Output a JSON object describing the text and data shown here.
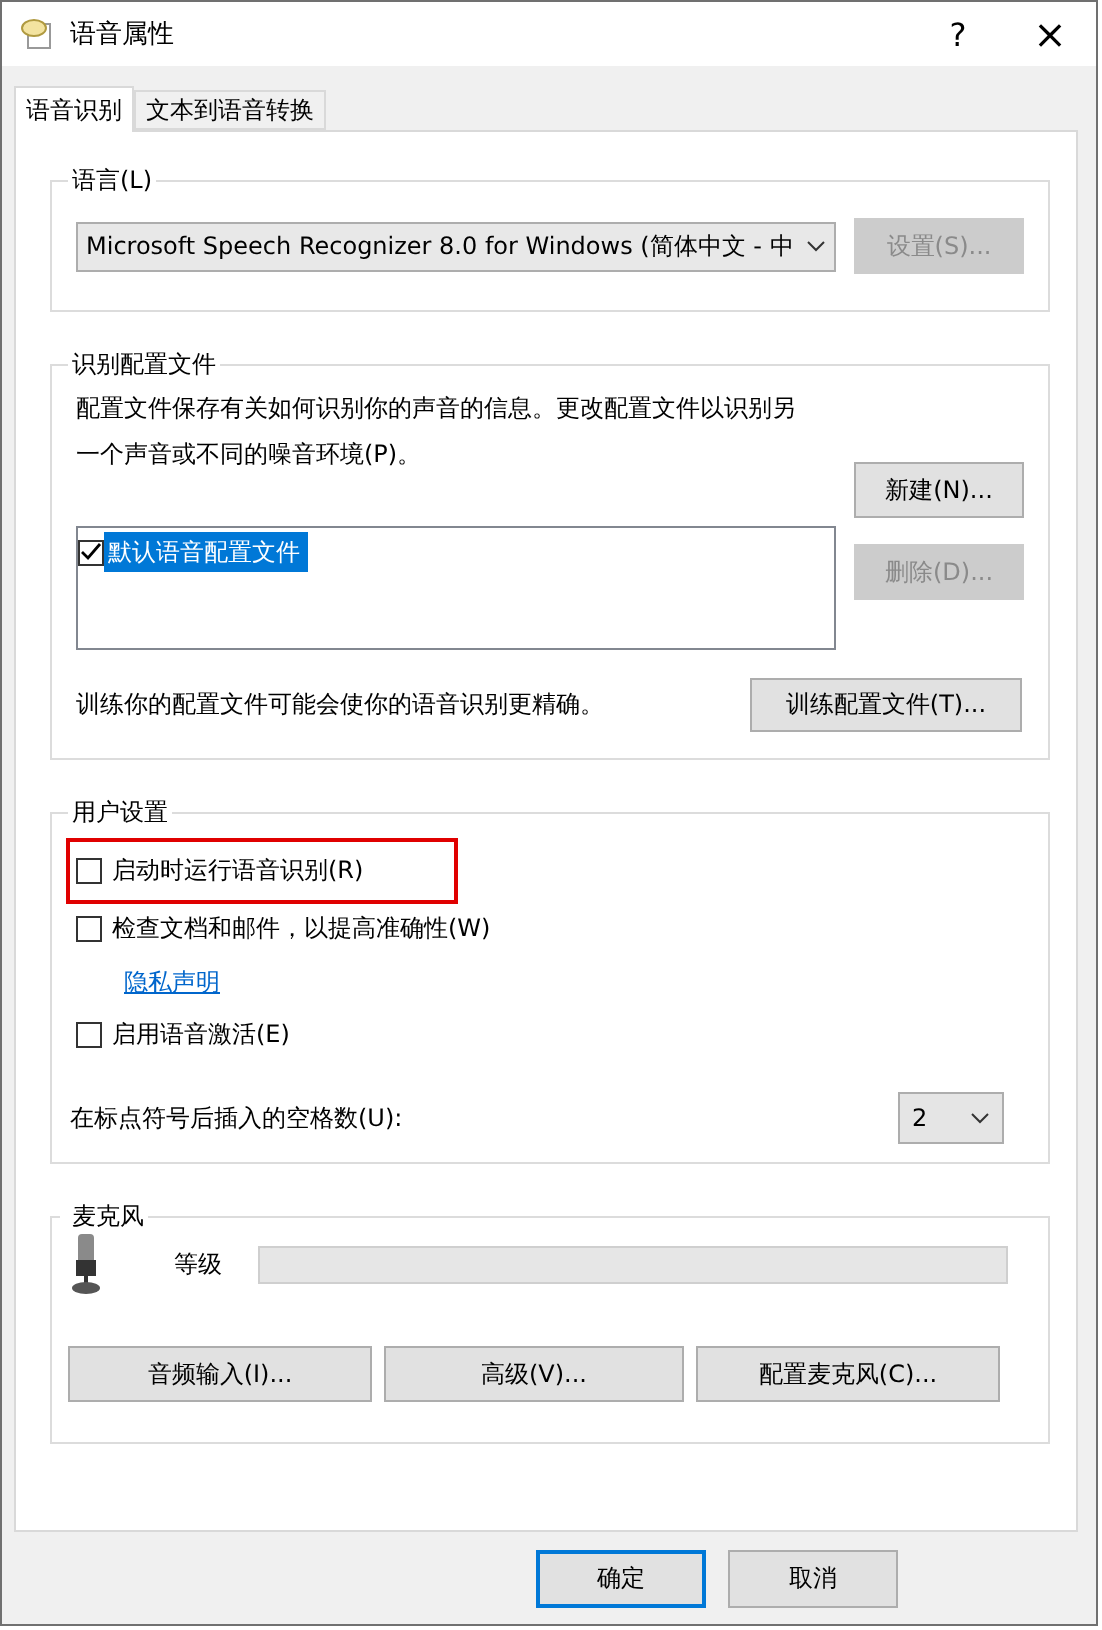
{
  "window": {
    "title": "语音属性",
    "help": "?",
    "close": "×"
  },
  "tabs": [
    {
      "label": "语音识别",
      "selected": true
    },
    {
      "label": "文本到语音转换",
      "selected": false
    }
  ],
  "language": {
    "legend": "语言(L)",
    "recognizer": "Microsoft Speech Recognizer 8.0 for Windows (简体中文 - 中",
    "settings_button": {
      "label": "设置(S)...",
      "disabled": true
    }
  },
  "profiles": {
    "legend": "识别配置文件",
    "description": "配置文件保存有关如何识别你的声音的信息。更改配置文件以识别另一个声音或不同的噪音环境(P)。",
    "new_button": {
      "label": "新建(N)...",
      "disabled": false
    },
    "delete_button": {
      "label": "删除(D)...",
      "disabled": true
    },
    "items": [
      {
        "label": "默认语音配置文件",
        "checked": true,
        "selected": true
      }
    ],
    "train_text": "训练你的配置文件可能会使你的语音识别更精确。",
    "train_button": {
      "label": "训练配置文件(T)...",
      "disabled": false
    }
  },
  "user_settings": {
    "legend": "用户设置",
    "options": [
      {
        "kind": "checkbox",
        "label": "启动时运行语音识别(R)",
        "checked": false,
        "highlighted": true
      },
      {
        "kind": "checkbox",
        "label": "检查文档和邮件，以提高准确性(W)",
        "checked": false,
        "highlighted": false
      },
      {
        "kind": "link",
        "label": "隐私声明"
      },
      {
        "kind": "checkbox",
        "label": "启用语音激活(E)",
        "checked": false,
        "highlighted": false
      }
    ],
    "spaces_label": "在标点符号后插入的空格数(U):",
    "spaces_value": "2"
  },
  "microphone": {
    "legend": "麦克风",
    "level_label": "等级",
    "level": 0,
    "buttons": [
      "音频输入(I)...",
      "高级(V)...",
      "配置麦克风(C)..."
    ]
  },
  "dialog_buttons": [
    {
      "label": "确定",
      "default": true
    },
    {
      "label": "取消",
      "default": false
    }
  ]
}
